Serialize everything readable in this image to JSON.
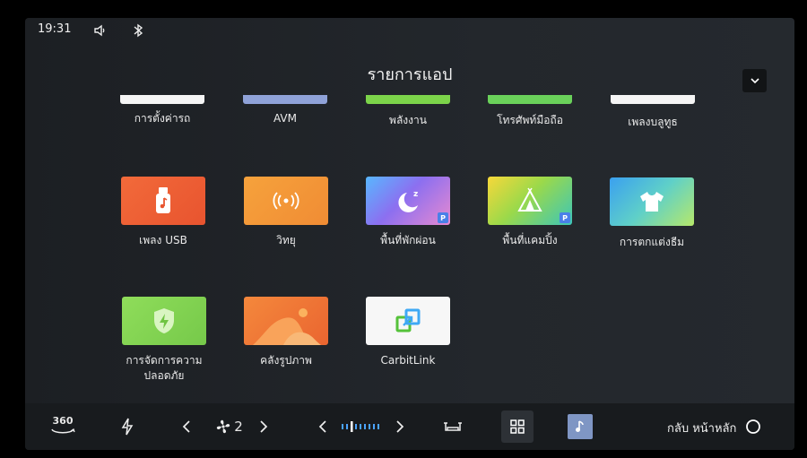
{
  "status": {
    "time": "19:31",
    "icons": [
      "volume-low-icon",
      "bluetooth-icon"
    ]
  },
  "header": {
    "title": "รายการแอป"
  },
  "apps_partial": [
    {
      "label": "การตั้งค่ารถ",
      "color": "#ffffff"
    },
    {
      "label": "AVM",
      "color": "#8fa2d8"
    },
    {
      "label": "พลังงาน",
      "color": "#7cd44a"
    },
    {
      "label": "โทรศัพท์มือถือ",
      "color": "#6ad15a"
    },
    {
      "label": "เพลงบลูทูธ",
      "color": "#ffffff"
    }
  ],
  "apps": [
    {
      "label": "เพลง USB",
      "icon": "usb-music-icon"
    },
    {
      "label": "วิทยุ",
      "icon": "radio-icon"
    },
    {
      "label": "พื้นที่พักผ่อน",
      "icon": "moon-icon",
      "badge": "P"
    },
    {
      "label": "พื้นที่แคมปิ้ง",
      "icon": "tent-icon",
      "badge": "P"
    },
    {
      "label": "การตกแต่งธีม",
      "icon": "tshirt-icon"
    },
    {
      "label": "การจัดการความ ปลอดภัย",
      "label_line1": "การจัดการความ",
      "label_line2": "ปลอดภัย",
      "icon": "shield-bolt-icon"
    },
    {
      "label": "คลังรูปภาพ",
      "icon": "gallery-icon"
    },
    {
      "label": "CarbitLink",
      "icon": "carbitlink-icon"
    }
  ],
  "dock": {
    "view360": "360",
    "fan_speed": "2",
    "home_label": "กลับ หน้าหลัก"
  }
}
